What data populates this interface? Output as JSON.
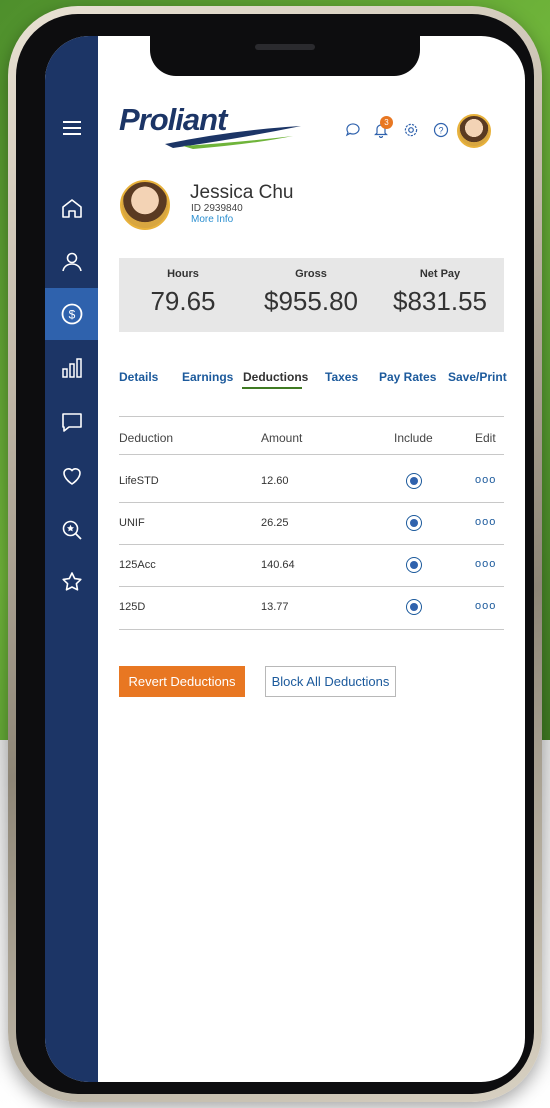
{
  "brand": {
    "logo_text": "Proliant",
    "accent": "#e87722",
    "navy": "#1c3566",
    "green": "#4e8f2c"
  },
  "sidebar": {
    "items": [
      {
        "icon": "menu-icon"
      },
      {
        "icon": "home-icon"
      },
      {
        "icon": "user-icon"
      },
      {
        "icon": "dollar-icon",
        "active": true
      },
      {
        "icon": "bar-chart-icon"
      },
      {
        "icon": "chat-icon"
      },
      {
        "icon": "heart-icon"
      },
      {
        "icon": "search-star-icon"
      },
      {
        "icon": "star-icon"
      }
    ]
  },
  "header": {
    "icons": [
      "chat-icon",
      "bell-icon",
      "gear-icon",
      "help-icon",
      "avatar"
    ],
    "notification_count": "3"
  },
  "employee": {
    "name": "Jessica Chu",
    "id_line": "ID 2939840",
    "more_info": "More Info"
  },
  "summary": {
    "hours_label": "Hours",
    "hours_value": "79.65",
    "gross_label": "Gross",
    "gross_value": "$955.80",
    "net_label": "Net Pay",
    "net_value": "$831.55"
  },
  "tabs": [
    "Details",
    "Earnings",
    "Deductions",
    "Taxes",
    "Pay Rates",
    "Save/Print"
  ],
  "active_tab": "Deductions",
  "table": {
    "headers": [
      "Deduction",
      "Amount",
      "Include",
      "Edit"
    ],
    "rows": [
      {
        "deduction": "LifeSTD",
        "amount": "12.60",
        "include": true,
        "edit": "ooo"
      },
      {
        "deduction": "UNIF",
        "amount": "26.25",
        "include": true,
        "edit": "ooo"
      },
      {
        "deduction": "125Acc",
        "amount": "140.64",
        "include": true,
        "edit": "ooo"
      },
      {
        "deduction": "125D",
        "amount": "13.77",
        "include": true,
        "edit": "ooo"
      }
    ]
  },
  "actions": {
    "revert_label": "Revert Deductions",
    "block_label": "Block All Deductions"
  }
}
